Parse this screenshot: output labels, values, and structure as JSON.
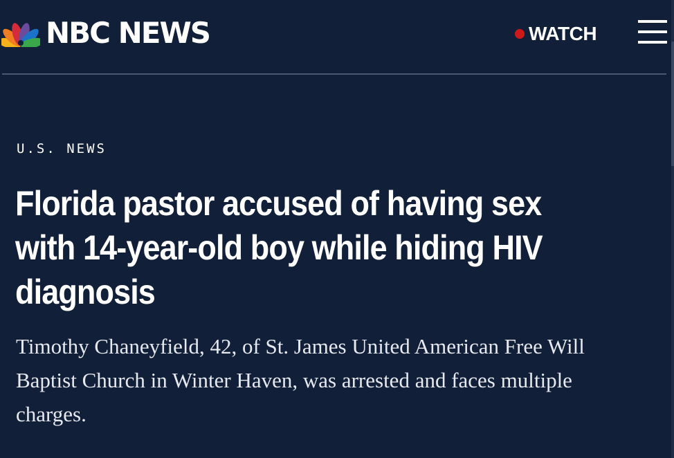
{
  "header": {
    "logo_text": "NBC NEWS",
    "logo_icon": "nbc-peacock-icon",
    "watch_label": "WATCH",
    "watch_icon": "live-dot-icon",
    "menu_icon": "hamburger-menu-icon"
  },
  "article": {
    "section": "U.S. NEWS",
    "headline": "Florida pastor accused of having sex with 14-year-old boy while hiding HIV diagnosis",
    "dek": "Timothy Chaneyfield, 42, of St. James United American Free Will Baptist Church in Winter Haven, was arrested and faces multiple charges."
  },
  "colors": {
    "background": "#111f38",
    "live_dot": "#cc1a1a",
    "divider": "#4c5870",
    "peacock": [
      "#f6b21b",
      "#ef7d22",
      "#d42c3a",
      "#6a4c9c",
      "#1a73c8",
      "#3aa84a"
    ]
  }
}
